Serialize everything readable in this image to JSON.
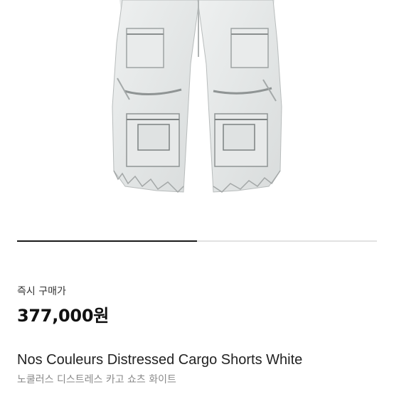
{
  "product": {
    "image_alt": "Nos Couleurs Distressed Cargo Shorts White",
    "carousel_progress": 0.5
  },
  "purchase": {
    "label": "즉시 구매가",
    "price": "377,000원"
  },
  "title": {
    "english": "Nos Couleurs Distressed Cargo Shorts White",
    "korean": "노쿨러스 디스트레스 카고 쇼츠 화이트"
  }
}
